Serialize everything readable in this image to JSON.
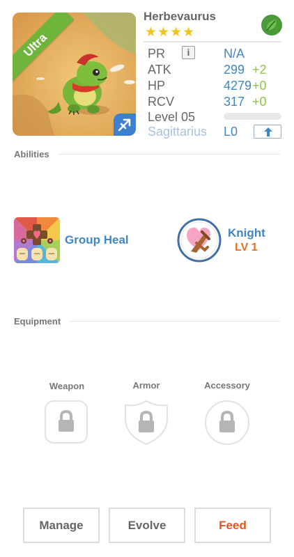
{
  "monster": {
    "name": "Herbevaurus",
    "stars": "★★★★",
    "rarity": "Ultra",
    "element_icon": "leaf-icon",
    "sign_icon": "sagittarius-arrow-icon"
  },
  "stats": {
    "pr_label": "PR",
    "pr_info": "i",
    "pr_value": "N/A",
    "atk_label": "ATK",
    "atk_value": "299",
    "atk_bonus": "+2",
    "hp_label": "HP",
    "hp_value": "4279",
    "hp_bonus": "+0",
    "rcv_label": "RCV",
    "rcv_value": "317",
    "rcv_bonus": "+0",
    "level_label": "Level 05",
    "level_progress": 0,
    "sign_label": "Sagittarius",
    "sign_level": "L0"
  },
  "abilities": {
    "title": "Abilities",
    "skill_name": "Group Heal",
    "class_name": "Knight",
    "class_level": "LV 1"
  },
  "equipment": {
    "title": "Equipment",
    "weapon_label": "Weapon",
    "armor_label": "Armor",
    "accessory_label": "Accessory"
  },
  "actions": {
    "manage": "Manage",
    "evolve": "Evolve",
    "feed": "Feed"
  },
  "colors": {
    "accent_blue": "#3f86c4",
    "bonus_green": "#8dc63f",
    "feed_orange": "#e0551d",
    "rarity_green": "#6fb43a"
  }
}
